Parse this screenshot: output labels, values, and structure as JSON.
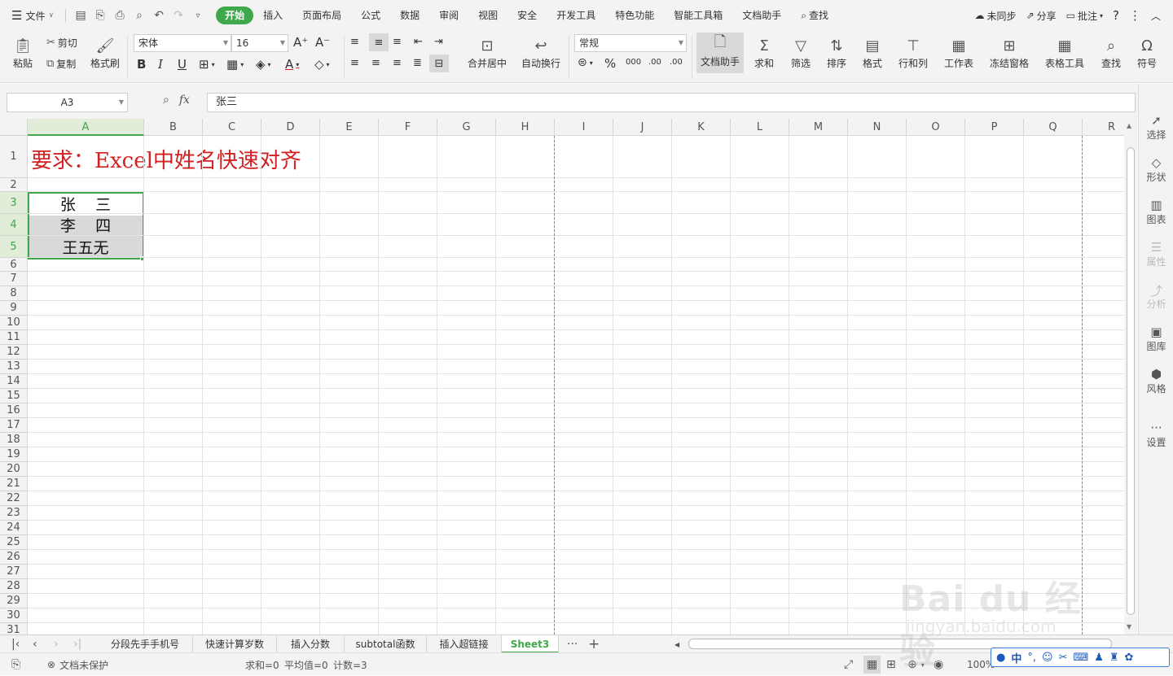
{
  "titlebar": {
    "file_label": "文件",
    "tabs": [
      "开始",
      "插入",
      "页面布局",
      "公式",
      "数据",
      "审阅",
      "视图",
      "安全",
      "开发工具",
      "特色功能",
      "智能工具箱",
      "文档助手"
    ],
    "active_tab": "开始",
    "search_label": "查找",
    "sync_label": "未同步",
    "share_label": "分享",
    "comment_label": "批注",
    "help_label": "?"
  },
  "ribbon": {
    "paste": "粘贴",
    "cut": "剪切",
    "copy": "复制",
    "format_painter": "格式刷",
    "font_name": "宋体",
    "font_size": "16",
    "bold": "B",
    "italic": "I",
    "underline": "U",
    "merge_center": "合并居中",
    "wrap_text": "自动换行",
    "number_format": "常规",
    "percent": "%",
    "thousands": "000",
    "inc_decimal": ".00",
    "dec_decimal": ".00",
    "doc_helper": "文档助手",
    "sum": "求和",
    "filter": "筛选",
    "sort": "排序",
    "format": "格式",
    "row_col": "行和列",
    "worksheet": "工作表",
    "freeze": "冻结窗格",
    "table_tools": "表格工具",
    "find": "查找",
    "symbol": "符号"
  },
  "formula_bar": {
    "name_box": "A3",
    "fx_label": "fx",
    "value": "张三"
  },
  "grid": {
    "columns": [
      "A",
      "B",
      "C",
      "D",
      "E",
      "F",
      "G",
      "H",
      "I",
      "J",
      "K",
      "L",
      "M",
      "N",
      "O",
      "P",
      "Q",
      "R"
    ],
    "rows": [
      "1",
      "2",
      "3",
      "4",
      "5",
      "6",
      "7",
      "8",
      "9",
      "10",
      "11",
      "12",
      "13",
      "14",
      "15",
      "16",
      "17",
      "18",
      "19",
      "20",
      "21",
      "22",
      "23",
      "24",
      "25",
      "26",
      "27",
      "28",
      "29",
      "30",
      "31"
    ],
    "title_text": "要求：Excel中姓名快速对齐",
    "names": [
      "张    三",
      "李    四",
      "王五无"
    ],
    "selected_column": "A",
    "selected_rows": [
      "3",
      "4",
      "5"
    ],
    "colors": {
      "title": "#d42020",
      "selection": "#3ea84a"
    }
  },
  "right_panel": [
    "选择",
    "形状",
    "图表",
    "属性",
    "分析",
    "图库",
    "风格",
    "设置"
  ],
  "sheets": {
    "tabs": [
      "分段先手手机号",
      "快速计算岁数",
      "插入分数",
      "subtotal函数",
      "插入超链接",
      "Sheet3"
    ],
    "active": "Sheet3",
    "more": "···",
    "add": "+"
  },
  "status": {
    "protect": "文档未保护",
    "sum": "求和=0",
    "avg": "平均值=0",
    "count": "计数=3",
    "zoom": "100%"
  },
  "ime": {
    "lang": "中",
    "dots": "°,"
  },
  "watermark": {
    "brand": "Bai du 经验",
    "url": "jingyan.baidu.com"
  }
}
